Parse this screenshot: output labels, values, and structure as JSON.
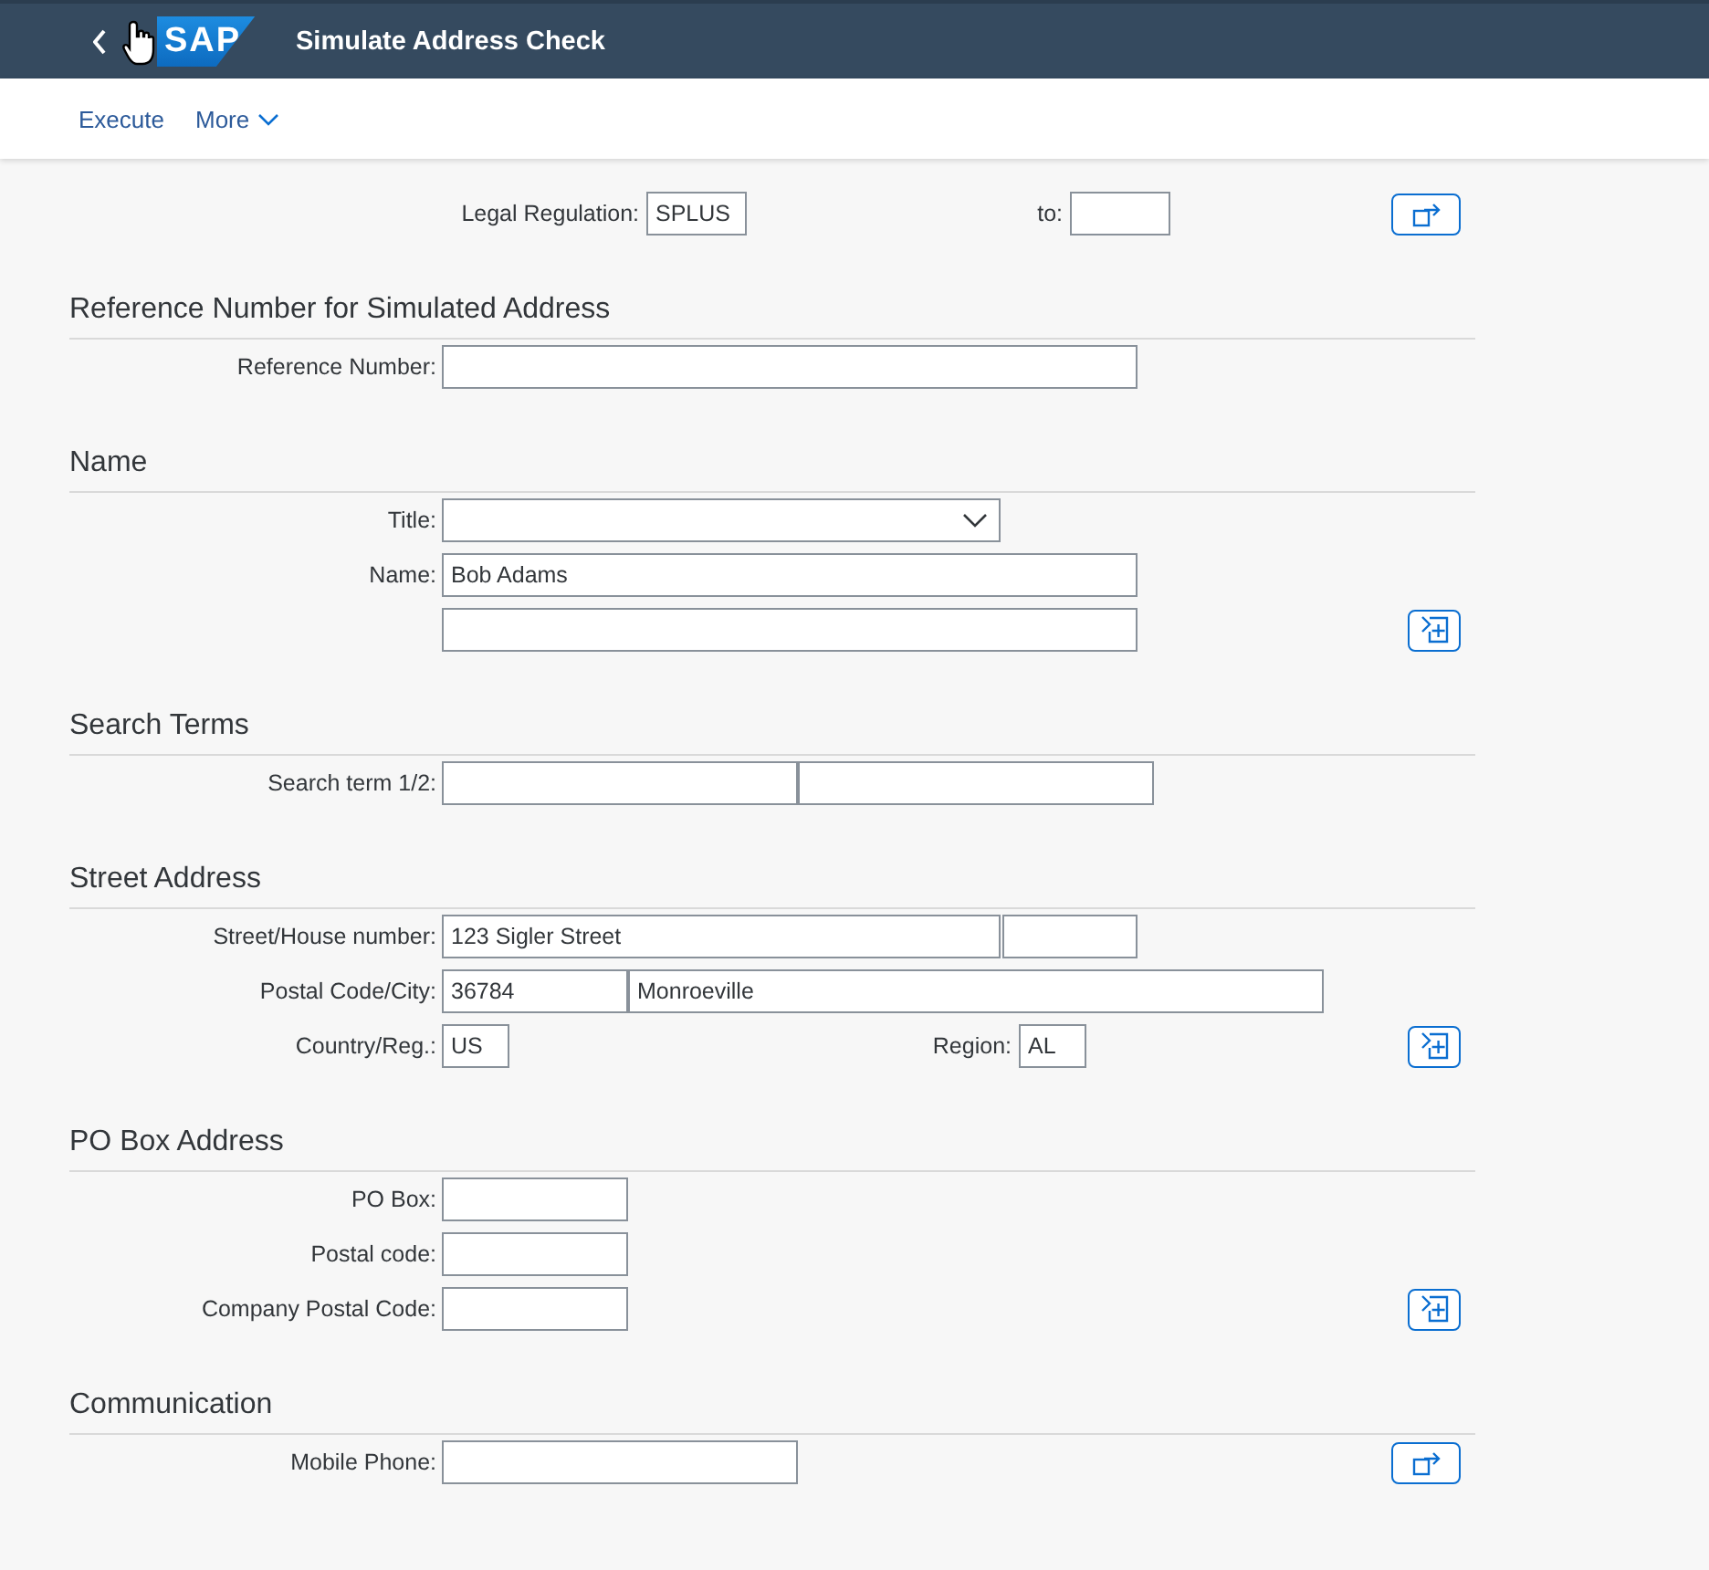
{
  "header": {
    "logo": "SAP",
    "title": "Simulate Address Check"
  },
  "toolbar": [
    {
      "kind": "link",
      "label": "Execute"
    },
    {
      "kind": "menu",
      "label": "More"
    }
  ],
  "top_row": {
    "items": [
      {
        "kind": "label",
        "text": "Legal Regulation:"
      },
      {
        "kind": "field",
        "value": "SPLUS"
      },
      {
        "kind": "label",
        "text": "to:"
      },
      {
        "kind": "field"
      },
      {
        "kind": "open_button"
      }
    ]
  },
  "sections": [
    {
      "title": "Reference Number for Simulated Address",
      "rows": [
        {
          "items": [
            {
              "kind": "label",
              "text": "Reference Number:"
            },
            {
              "kind": "field"
            }
          ]
        }
      ]
    },
    {
      "title": "Name",
      "rows": [
        {
          "items": [
            {
              "kind": "label",
              "text": "Title:"
            },
            {
              "kind": "dropdown"
            }
          ]
        },
        {
          "items": [
            {
              "kind": "label",
              "text": "Name:"
            },
            {
              "kind": "field",
              "value": "Bob Adams"
            }
          ]
        },
        {
          "items": [
            {
              "kind": "field"
            },
            {
              "kind": "add_button"
            }
          ]
        }
      ]
    },
    {
      "title": "Search Terms",
      "rows": [
        {
          "items": [
            {
              "kind": "label",
              "text": "Search term 1/2:"
            },
            {
              "kind": "field"
            },
            {
              "kind": "field"
            }
          ]
        }
      ]
    },
    {
      "title": "Street Address",
      "rows": [
        {
          "items": [
            {
              "kind": "label",
              "text": "Street/House number:"
            },
            {
              "kind": "field",
              "value": "123 Sigler Street"
            },
            {
              "kind": "field"
            }
          ]
        },
        {
          "items": [
            {
              "kind": "label",
              "text": "Postal Code/City:"
            },
            {
              "kind": "field",
              "value": "36784"
            },
            {
              "kind": "field",
              "value": "Monroeville"
            }
          ]
        },
        {
          "items": [
            {
              "kind": "label",
              "text": "Country/Reg.:"
            },
            {
              "kind": "field",
              "value": "US"
            },
            {
              "kind": "label",
              "text": "Region:"
            },
            {
              "kind": "field",
              "value": "AL"
            },
            {
              "kind": "add_button"
            }
          ]
        }
      ]
    },
    {
      "title": "PO Box Address",
      "rows": [
        {
          "items": [
            {
              "kind": "label",
              "text": "PO Box:"
            },
            {
              "kind": "field"
            }
          ]
        },
        {
          "items": [
            {
              "kind": "label",
              "text": "Postal code:"
            },
            {
              "kind": "field"
            }
          ]
        },
        {
          "items": [
            {
              "kind": "label",
              "text": "Company Postal Code:"
            },
            {
              "kind": "field"
            },
            {
              "kind": "add_button"
            }
          ]
        }
      ]
    },
    {
      "title": "Communication",
      "rows": [
        {
          "items": [
            {
              "kind": "label",
              "text": "Mobile Phone:"
            },
            {
              "kind": "field"
            },
            {
              "kind": "open_button"
            }
          ]
        }
      ]
    }
  ]
}
